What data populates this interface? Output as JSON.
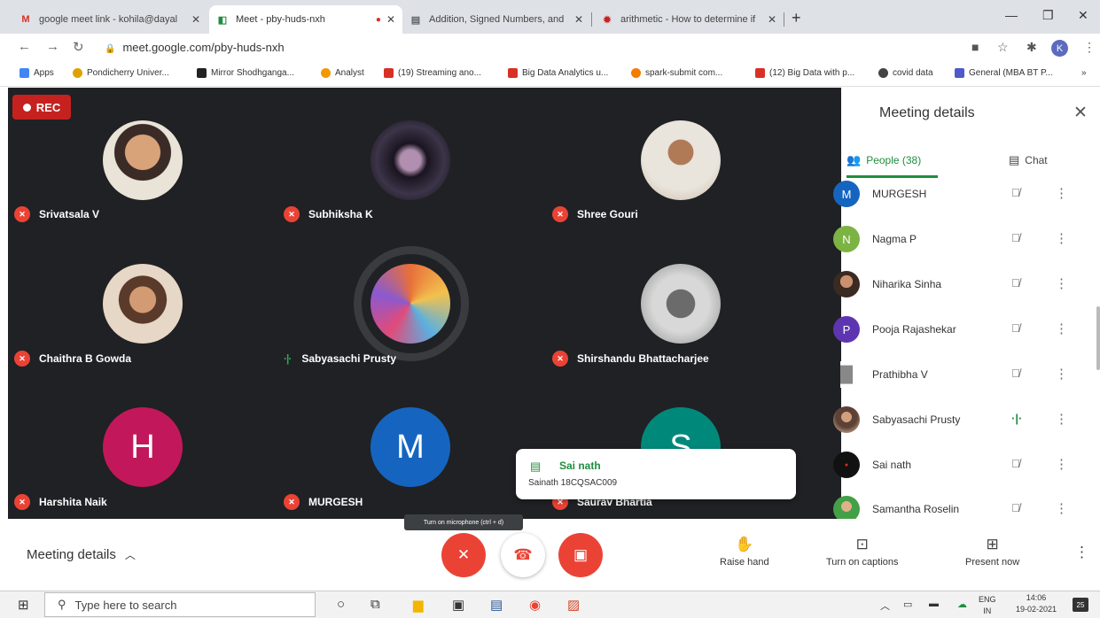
{
  "browser": {
    "tabs": [
      {
        "title": "google meet link - kohila@dayal",
        "icon": "gmail-icon",
        "color": "#d93025",
        "glyph": "M"
      },
      {
        "title": "Meet - pby-huds-nxh",
        "icon": "meet-icon",
        "color": "#1e8e3e",
        "glyph": "◧"
      },
      {
        "title": "Addition, Signed Numbers, and",
        "icon": "document-icon",
        "color": "#5f6368",
        "glyph": "▤"
      },
      {
        "title": "arithmetic - How to determine if",
        "icon": "stackexchange-icon",
        "color": "#c5221f",
        "glyph": "✹"
      }
    ],
    "recording_indicator": "recording-dot-icon",
    "new_tab": "+",
    "url": "meet.google.com/pby-huds-nxh",
    "profile_initial": "K",
    "bookmarks": [
      {
        "label": "Apps",
        "color": "#4285f4"
      },
      {
        "label": "Pondicherry Univer...",
        "color": "#e0a100"
      },
      {
        "label": "Mirror Shodhganga...",
        "color": "#222222"
      },
      {
        "label": "Analyst",
        "color": "#f29900"
      },
      {
        "label": "(19) Streaming ano...",
        "color": "#d93025"
      },
      {
        "label": "Big Data Analytics u...",
        "color": "#d93025"
      },
      {
        "label": "spark-submit com...",
        "color": "#f57c00"
      },
      {
        "label": "(12) Big Data with p...",
        "color": "#d93025"
      },
      {
        "label": "covid data",
        "color": "#444444"
      },
      {
        "label": "General (MBA BT P...",
        "color": "#5059c9"
      }
    ],
    "bookmarks_more": "»"
  },
  "meeting": {
    "rec_label": "REC",
    "participants_grid": [
      {
        "name": "Srivatsala V",
        "status": "muted"
      },
      {
        "name": "Subhiksha K",
        "status": "muted"
      },
      {
        "name": "Shree Gouri",
        "status": "muted"
      },
      {
        "name": "Chaithra B Gowda",
        "status": "muted"
      },
      {
        "name": "Sabyasachi Prusty",
        "status": "speaking"
      },
      {
        "name": "Shirshandu Bhattacharjee",
        "status": "muted"
      },
      {
        "name": "Harshita Naik",
        "status": "muted",
        "initial": "H",
        "color": "#c2185b"
      },
      {
        "name": "MURGESH",
        "status": "muted",
        "initial": "M",
        "color": "#1565c0"
      },
      {
        "name": "Saurav Bhartia",
        "status": "muted",
        "initial": "S",
        "color": "#00897b"
      }
    ],
    "chat_popup": {
      "sender": "Sai nath",
      "message": "Sainath 18CQSAC009"
    }
  },
  "panel": {
    "title": "Meeting details",
    "tab_people": "People (38)",
    "tab_chat": "Chat",
    "people": [
      {
        "name": "MURGESH",
        "initial": "M",
        "color": "#1565c0",
        "status": "muted"
      },
      {
        "name": "Nagma P",
        "initial": "N",
        "color": "#7cb342",
        "status": "muted"
      },
      {
        "name": "Niharika Sinha",
        "initial": "",
        "color": "#6d4c41",
        "status": "muted"
      },
      {
        "name": "Pooja Rajashekar",
        "initial": "P",
        "color": "#5e35b1",
        "status": "muted"
      },
      {
        "name": "Prathibha V",
        "initial": "",
        "color": "#9e9e9e",
        "status": "muted"
      },
      {
        "name": "Sabyasachi Prusty",
        "initial": "",
        "color": "#795548",
        "status": "speaking"
      },
      {
        "name": "Sai nath",
        "initial": "",
        "color": "#111111",
        "status": "muted"
      },
      {
        "name": "Samantha Roselin",
        "initial": "",
        "color": "#43a047",
        "status": "muted"
      }
    ]
  },
  "controls": {
    "meeting_details": "Meeting details",
    "mic_tooltip": "Turn on microphone (ctrl + d)",
    "raise_hand": "Raise hand",
    "captions": "Turn on captions",
    "present": "Present now"
  },
  "taskbar": {
    "search_placeholder": "Type here to search",
    "lang1": "ENG",
    "lang2": "IN",
    "time": "14:06",
    "date": "19-02-2021",
    "notifications": "25"
  }
}
